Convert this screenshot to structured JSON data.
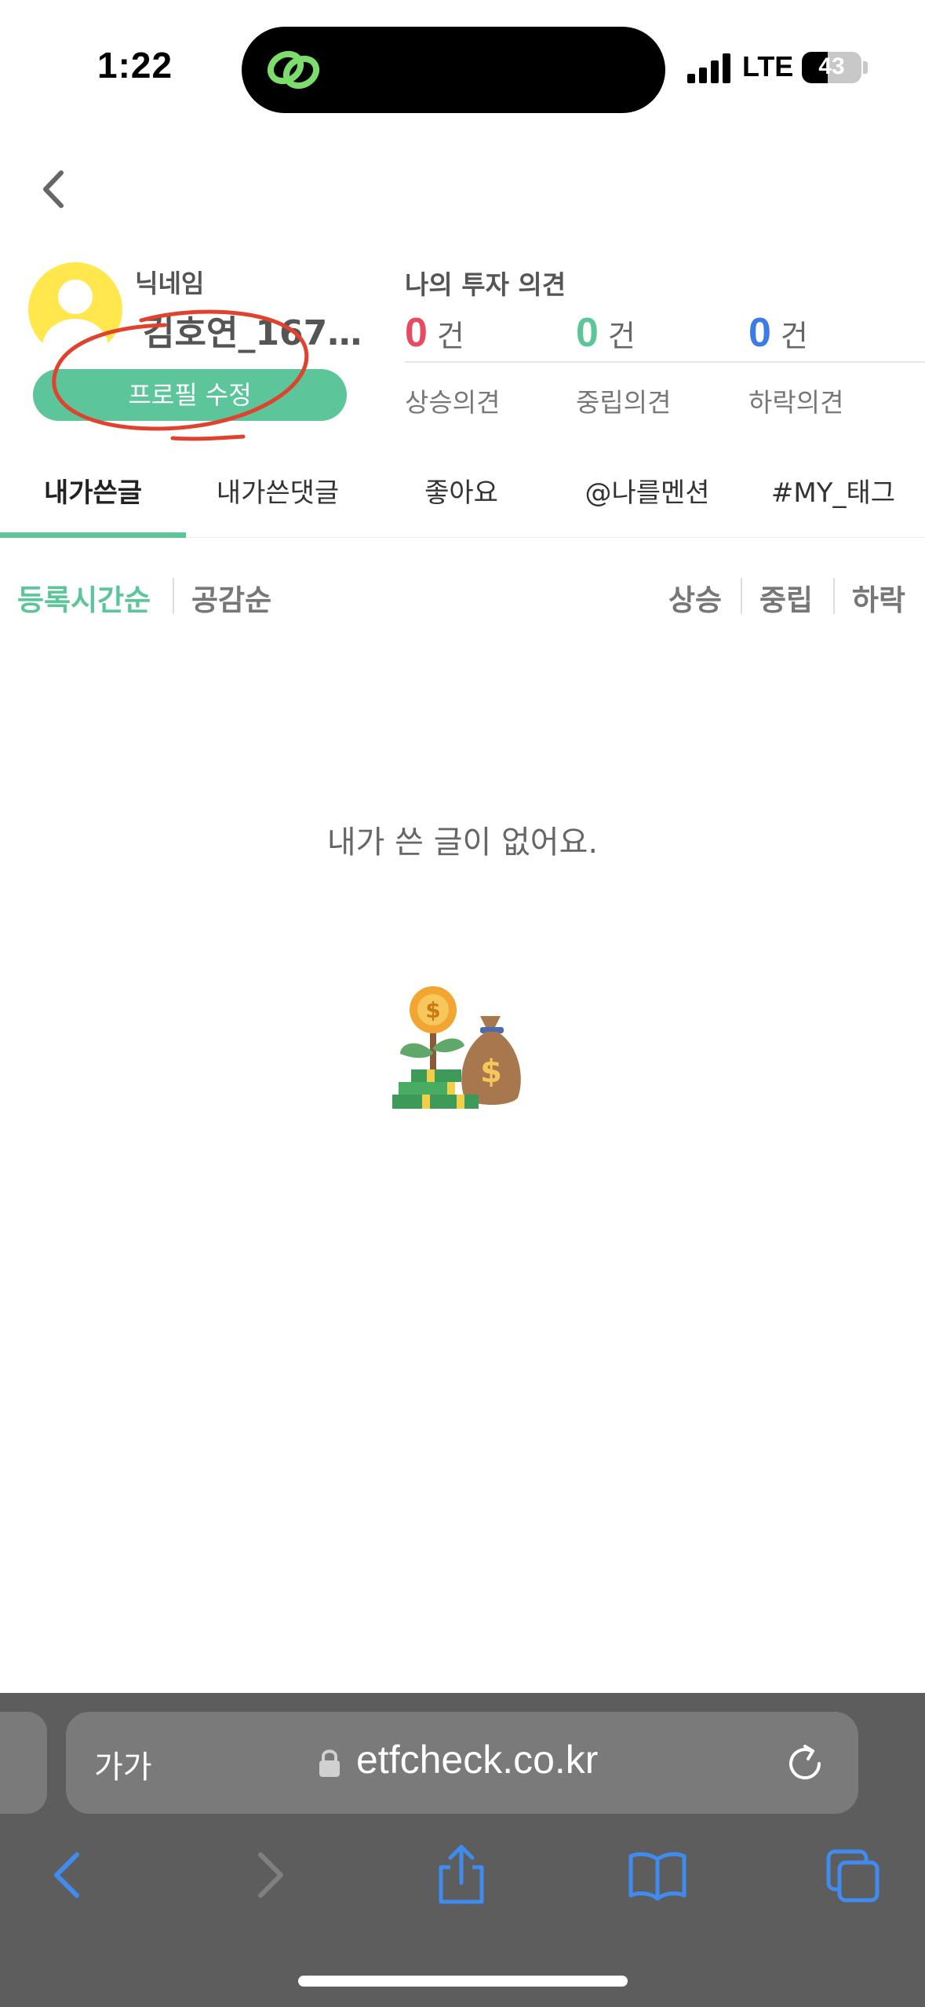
{
  "status_bar": {
    "time": "1:22",
    "network": "LTE",
    "battery": "43",
    "battery_level": 0.43
  },
  "profile": {
    "nickname_label": "닉네임",
    "nickname": "김호연_1670...",
    "edit_button": "프로필 수정"
  },
  "opinions": {
    "title": "나의 투자 의견",
    "unit": "건",
    "items": [
      {
        "count": "0",
        "label": "상승의견",
        "color": "#e84a5f"
      },
      {
        "count": "0",
        "label": "중립의견",
        "color": "#5cc59a"
      },
      {
        "count": "0",
        "label": "하락의견",
        "color": "#3d7be6"
      }
    ]
  },
  "tabs": [
    {
      "label": "내가쓴글",
      "active": true
    },
    {
      "label": "내가쓴댓글",
      "active": false
    },
    {
      "label": "좋아요",
      "active": false
    },
    {
      "label": "@나를멘션",
      "active": false
    },
    {
      "label": "#MY_태그",
      "active": false
    }
  ],
  "sort": {
    "left": [
      "등록시간순",
      "공감순"
    ],
    "right": [
      "상승",
      "중립",
      "하락"
    ]
  },
  "empty_state": {
    "message": "내가 쓴 글이 없어요."
  },
  "browser": {
    "text_size_label": "가가",
    "url": "etfcheck.co.kr"
  },
  "colors": {
    "accent": "#5cc59a",
    "annotation": "#e0422e",
    "browser_bg": "#5d5d5d"
  },
  "icons": [
    "back-icon",
    "user-avatar-icon",
    "lock-icon",
    "reload-icon",
    "back-nav-icon",
    "forward-nav-icon",
    "share-icon",
    "bookmarks-icon",
    "tabs-icon"
  ]
}
